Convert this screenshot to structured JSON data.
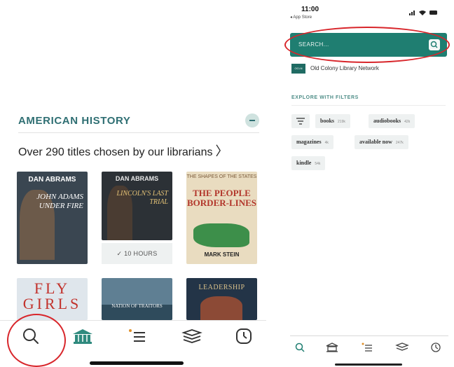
{
  "left": {
    "section_title": "AMERICAN HISTORY",
    "subtitle": "Over 290 titles chosen by our librarians",
    "subtitle_chevron": "〉",
    "books": [
      {
        "author": "DAN ABRAMS",
        "title": "JOHN ADAMS UNDER FIRE"
      },
      {
        "author": "DAN ABRAMS",
        "title": "LINCOLN'S LAST TRIAL"
      },
      {
        "tagline": "THE SHAPES OF THE STATES",
        "title": "THE PEOPLE BORDER-LINES",
        "author": "MARK STEIN"
      },
      {
        "title": "FLY GIRLS"
      },
      {
        "title": "NATION OF TRAITORS"
      },
      {
        "title": "LEADERSHIP"
      }
    ],
    "duration_badge": "10 HOURS",
    "tabs": [
      "search-icon",
      "library-icon",
      "list-icon",
      "shelf-icon",
      "history-icon"
    ]
  },
  "right": {
    "status": {
      "time": "11:00",
      "back": "◂ App Store"
    },
    "search_placeholder": "SEARCH...",
    "library_logo": "OCLN",
    "library_name": "Old Colony Library Network",
    "filters_label": "EXPLORE WITH FILTERS",
    "filter_chips": [
      {
        "label": "books",
        "count": "219k"
      },
      {
        "label": "audiobooks",
        "count": "42k"
      },
      {
        "label": "magazines",
        "count": "4k"
      },
      {
        "label": "available now",
        "count": "247k"
      },
      {
        "label": "kindle",
        "count": "54k"
      }
    ],
    "accent_color": "#1f7e71",
    "annotation_color": "#d8262b"
  }
}
